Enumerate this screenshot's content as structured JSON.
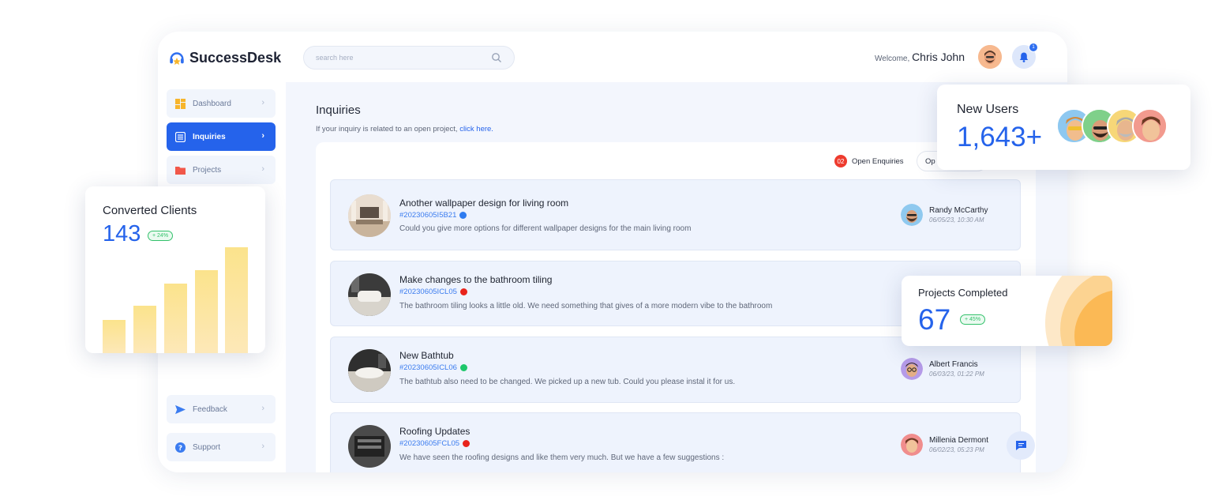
{
  "app": {
    "logo_text": "SuccessDesk"
  },
  "sidebar": {
    "items": [
      {
        "label": "Dashboard",
        "icon": "grid-icon"
      },
      {
        "label": "Inquiries",
        "icon": "list-icon",
        "active": true
      },
      {
        "label": "Projects",
        "icon": "folder-icon"
      }
    ],
    "bottom": [
      {
        "label": "Feedback",
        "icon": "send-icon"
      },
      {
        "label": "Support",
        "icon": "help-icon"
      }
    ]
  },
  "header": {
    "search_placeholder": "search here",
    "welcome_prefix": "Welcome,",
    "user_name": "Chris John",
    "notification_count": "1"
  },
  "main": {
    "title": "Inquiries",
    "subtitle": "If your inquiry is related to an open project,",
    "subtitle_link": "click here.",
    "open_count": "02",
    "open_label": "Open Enquiries",
    "tab_partial": "Op"
  },
  "inquiries": [
    {
      "title": "Another wallpaper design for living room",
      "code": "#20230605I5B21",
      "status_color": "#2f7cf0",
      "description": "Could you give more options for different wallpaper designs for the main living room",
      "person": "Randy McCarthy",
      "date": "06/05/23, 10:30 AM"
    },
    {
      "title": "Make changes to the bathroom tiling",
      "code": "#20230605ICL05",
      "status_color": "#e8231b",
      "description": "The bathroom tiling looks a little old. We need something that gives of a more modern vibe to the bathroom",
      "person": "",
      "date": ""
    },
    {
      "title": "New Bathtub",
      "code": "#20230605ICL06",
      "status_color": "#1ec76b",
      "description": "The bathtub also need to be changed. We picked up a new tub. Could you please instal it for us.",
      "person": "Albert Francis",
      "date": "06/03/23, 01:22 PM"
    },
    {
      "title": "Roofing Updates",
      "code": "#20230605FCL05",
      "status_color": "#e8231b",
      "description": "We have seen the roofing designs and like them very much. But we have a few suggestions :",
      "person": "Millenia Dermont",
      "date": "06/02/23, 05:23 PM"
    }
  ],
  "converted": {
    "title": "Converted Clients",
    "value": "143",
    "change": "+ 24%",
    "bars": [
      0.31,
      0.45,
      0.66,
      0.78,
      1.0
    ]
  },
  "new_users": {
    "title": "New Users",
    "value": "1,643+"
  },
  "projects_completed": {
    "title": "Projects Completed",
    "value": "67",
    "change": "+ 45%"
  }
}
